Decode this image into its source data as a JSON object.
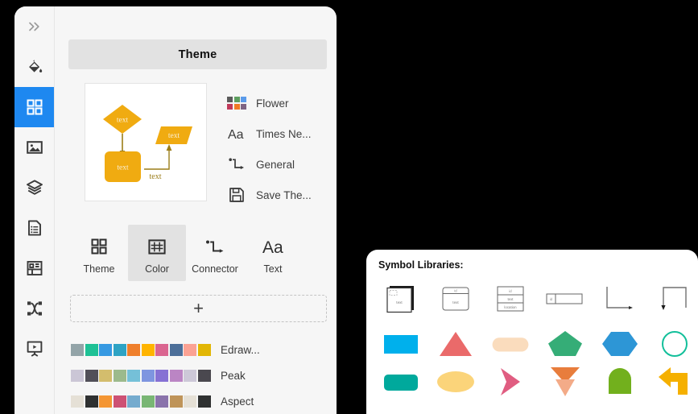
{
  "app": {
    "panel_title": "Theme"
  },
  "sidebar": {
    "items": [
      {
        "name": "expand-chevrons",
        "icon": "chevrons-right-icon",
        "selected": false
      },
      {
        "name": "fill-color",
        "icon": "paint-bucket-icon",
        "selected": false
      },
      {
        "name": "theme",
        "icon": "theme-grid-icon",
        "selected": true
      },
      {
        "name": "image",
        "icon": "image-icon",
        "selected": false
      },
      {
        "name": "layers",
        "icon": "layers-icon",
        "selected": false
      },
      {
        "name": "document",
        "icon": "document-list-icon",
        "selected": false
      },
      {
        "name": "chart",
        "icon": "chart-icon",
        "selected": false
      },
      {
        "name": "shuffle",
        "icon": "shuffle-icon",
        "selected": false
      },
      {
        "name": "presentation",
        "icon": "presentation-icon",
        "selected": false
      }
    ]
  },
  "preview": {
    "shape_labels": [
      "text",
      "text",
      "text"
    ],
    "connector_label": "text",
    "fill_color": "#f0ab11",
    "line_color": "#9b7d18"
  },
  "theme_list": [
    {
      "label": "Flower",
      "icon": "color-grid-icon",
      "swatches": [
        "#5b5b5b",
        "#5d9e5f",
        "#5b9bea",
        "#c03a5b",
        "#f07a25",
        "#7e6483"
      ]
    },
    {
      "label": "Times Ne...",
      "icon": "font-icon"
    },
    {
      "label": "General",
      "icon": "connector-icon"
    },
    {
      "label": "Save The...",
      "icon": "save-icon"
    }
  ],
  "tabs": [
    {
      "label": "Theme",
      "icon": "theme-grid-icon",
      "selected": false
    },
    {
      "label": "Color",
      "icon": "color-table-icon",
      "selected": true
    },
    {
      "label": "Connector",
      "icon": "connector-icon",
      "selected": false
    },
    {
      "label": "Text",
      "icon": "font-icon",
      "selected": false
    }
  ],
  "add_button": {
    "glyph": "+",
    "label": "Add"
  },
  "palettes": [
    {
      "name": "Edraw...",
      "colors": [
        "#93a4a8",
        "#1ec195",
        "#3699e2",
        "#2ea3c4",
        "#ef7f2c",
        "#ffb400",
        "#da6590",
        "#4d6f99",
        "#fba294",
        "#e2b605"
      ]
    },
    {
      "name": "Peak",
      "colors": [
        "#cbc6d6",
        "#514f58",
        "#d3bd6d",
        "#9cba8c",
        "#75c0d8",
        "#7e95e0",
        "#8671d4",
        "#bb85c4",
        "#cdc8d8",
        "#4a484f"
      ]
    },
    {
      "name": "Aspect",
      "colors": [
        "#e5e0d6",
        "#2f3131",
        "#f49633",
        "#cd5174",
        "#75abce",
        "#79b674",
        "#8a73ab",
        "#bf9459",
        "#e5e0d6",
        "#2f3131"
      ]
    }
  ],
  "symbol_panel": {
    "title": "Symbol Libraries:",
    "row1": [
      {
        "name": "stacked-card-shape",
        "label": "text"
      },
      {
        "name": "titled-box-shape",
        "label": "text"
      },
      {
        "name": "three-row-table-shape",
        "label": "location"
      },
      {
        "name": "split-bar-shape",
        "label": "id"
      },
      {
        "name": "elbow-connector-right",
        "label": ""
      },
      {
        "name": "elbow-connector-down",
        "label": ""
      }
    ],
    "row2": [
      {
        "name": "rectangle-shape",
        "color": "#00b0ec"
      },
      {
        "name": "triangle-shape",
        "color": "#ea6a6a"
      },
      {
        "name": "rounded-rectangle-shape",
        "color": "#fadcbd"
      },
      {
        "name": "pentagon-shape",
        "color": "#35ad77"
      },
      {
        "name": "hexagon-shape",
        "color": "#2d96d6"
      },
      {
        "name": "circle-outline-shape",
        "color": "#12bf9a"
      }
    ],
    "row3": [
      {
        "name": "rounded-rectangle-filled-shape",
        "color": "#00a99c"
      },
      {
        "name": "ellipse-shape",
        "color": "#fbd47a"
      },
      {
        "name": "chevron-arrow-shape",
        "color": "#e05d81"
      },
      {
        "name": "double-down-arrow-shape",
        "color": "#e87d3c"
      },
      {
        "name": "arch-shape",
        "color": "#72b01d"
      },
      {
        "name": "turn-arrow-shape",
        "color": "#f5b000"
      }
    ]
  }
}
